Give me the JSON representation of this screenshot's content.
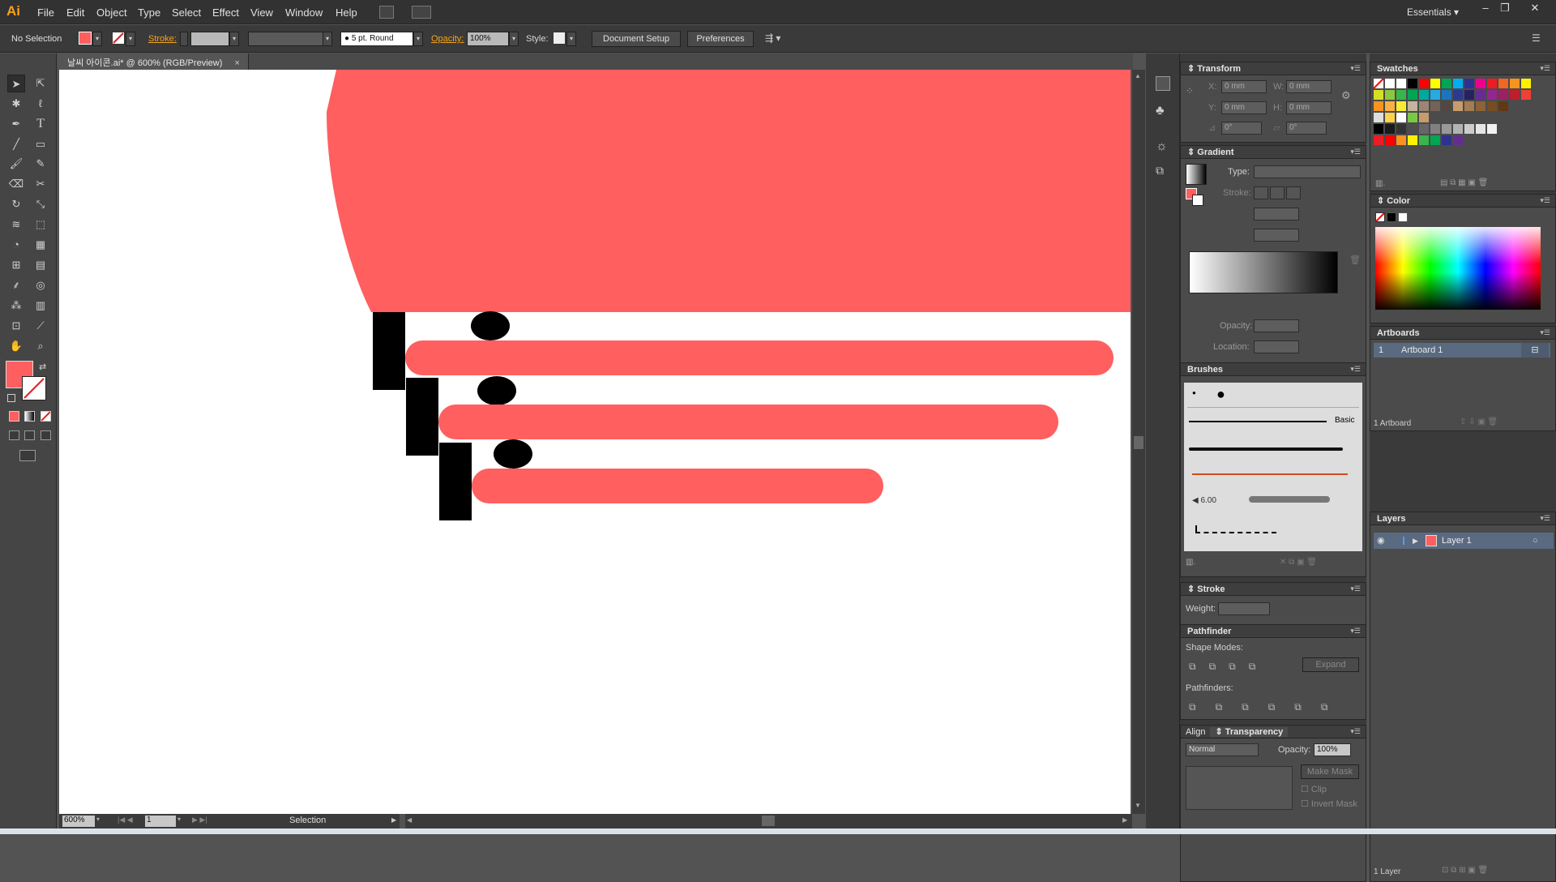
{
  "app": {
    "logo": "Ai",
    "workspace": "Essentials"
  },
  "menu": [
    "File",
    "Edit",
    "Object",
    "Type",
    "Select",
    "Effect",
    "View",
    "Window",
    "Help"
  ],
  "control": {
    "selection": "No Selection",
    "stroke_label": "Stroke:",
    "brush": "5 pt. Round",
    "opacity_label": "Opacity:",
    "opacity": "100%",
    "style_label": "Style:",
    "doc_setup": "Document Setup",
    "preferences": "Preferences"
  },
  "tab": {
    "title": "날씨 아이콘.ai* @ 600% (RGB/Preview)",
    "close": "×"
  },
  "status": {
    "zoom": "600%",
    "page": "1",
    "tool": "Selection"
  },
  "transform": {
    "title": "Transform",
    "x_label": "X:",
    "x": "0 mm",
    "w_label": "W:",
    "w": "0 mm",
    "y_label": "Y:",
    "y": "0 mm",
    "h_label": "H:",
    "h": "0 mm",
    "rot": "0°",
    "shear": "0°"
  },
  "gradient": {
    "title": "Gradient",
    "type_label": "Type:",
    "stroke_label": "Stroke:",
    "opacity_label": "Opacity:",
    "location_label": "Location:"
  },
  "brushes": {
    "title": "Brushes",
    "basic": "Basic",
    "size": "6.00"
  },
  "stroke": {
    "title": "Stroke",
    "weight_label": "Weight:"
  },
  "pathfinder": {
    "title": "Pathfinder",
    "shape_modes": "Shape Modes:",
    "pathfinders": "Pathfinders:",
    "expand": "Expand"
  },
  "transparency": {
    "align_tab": "Align",
    "title": "Transparency",
    "mode": "Normal",
    "opacity_label": "Opacity:",
    "opacity": "100%",
    "make_mask": "Make Mask",
    "clip": "Clip",
    "invert": "Invert Mask"
  },
  "swatches": {
    "title": "Swatches"
  },
  "color": {
    "title": "Color"
  },
  "artboards": {
    "title": "Artboards",
    "row_num": "1",
    "row_name": "Artboard 1",
    "count": "1 Artboard"
  },
  "layers": {
    "title": "Layers",
    "layer_name": "Layer 1",
    "count": "1 Layer"
  },
  "colors": {
    "accent": "#ff5f5f",
    "black": "#000000"
  }
}
